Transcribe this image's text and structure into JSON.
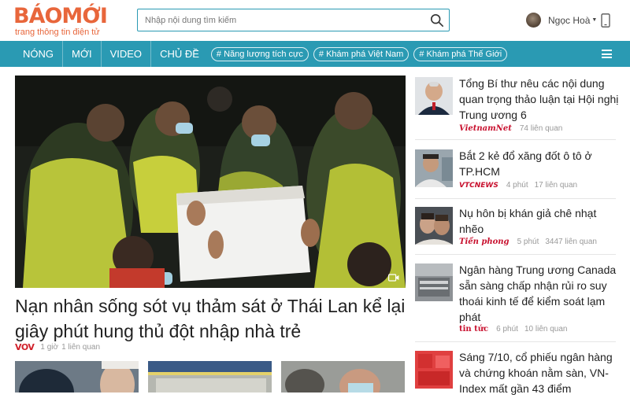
{
  "header": {
    "logo_text": "BÁOMỚI",
    "logo_tagline": "trang thông tin điện tử",
    "search_placeholder": "Nhập nội dung tìm kiếm",
    "user_name": "Ngọc Hoà",
    "icons": {
      "search": "search-icon",
      "phone": "mobile-phone-icon",
      "menu": "hamburger-menu-icon"
    }
  },
  "colors": {
    "brand": "#e8663b",
    "nav": "#2a9ab3",
    "source_red": "#c8102e"
  },
  "nav": {
    "items": [
      "NÓNG",
      "MỚI",
      "VIDEO",
      "CHỦ ĐỀ"
    ],
    "tags": [
      "# Năng lượng tích cực",
      "# Khám phá Việt Nam",
      "# Khám phá Thế Giới"
    ]
  },
  "hero": {
    "title": "Nạn nhân sống sót vụ thảm sát ở Thái Lan kể lại giây phút hung thủ đột nhập nhà trẻ",
    "source": "VOV",
    "time": "1 giờ",
    "related": "1 liên quan",
    "media_icon": "video-icon"
  },
  "sidebar": [
    {
      "title": "Tổng Bí thư nêu các nội dung quan trọng thảo luận tại Hội nghị Trung ương 6",
      "source": "VietnamNet",
      "time": "",
      "related": "74 liên quan"
    },
    {
      "title": "Bắt 2 kẻ đổ xăng đốt ô tô ở TP.HCM",
      "source": "VTCNEWS",
      "time": "4 phút",
      "related": "17 liên quan"
    },
    {
      "title": "Nụ hôn bị khán giả chê nhạt nhẽo",
      "source": "Tiền phong",
      "time": "5 phút",
      "related": "3447 liên quan"
    },
    {
      "title": "Ngân hàng Trung ương Canada sẵn sàng chấp nhận rủi ro suy thoái kinh tế để kiểm soát lạm phát",
      "source": "tin tức",
      "time": "6 phút",
      "related": "10 liên quan"
    },
    {
      "title": "Sáng 7/10, cổ phiếu ngân hàng và chứng khoán nằm sàn, VN-Index mất gần 43 điểm",
      "source": "",
      "time": "",
      "related": ""
    }
  ]
}
